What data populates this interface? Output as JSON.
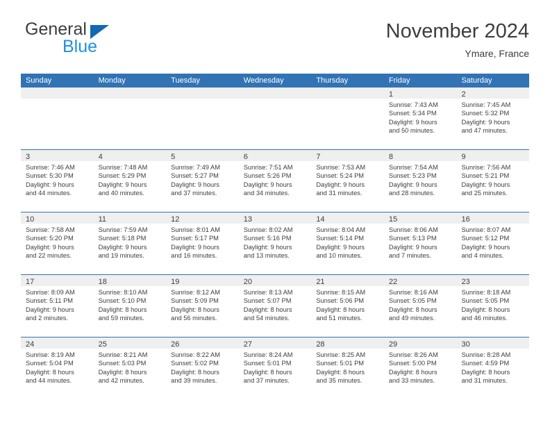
{
  "brand": {
    "name_primary": "General",
    "name_secondary": "Blue",
    "triangle_icon": "triangle-icon"
  },
  "header": {
    "title": "November 2024",
    "subtitle": "Ymare, France"
  },
  "colors": {
    "header_blue": "#3173b4",
    "brand_blue": "#1f8fe0",
    "brand_triangle_blue": "#1268b3",
    "day_band_gray": "#efefef",
    "text": "#3d3d3d"
  },
  "weekday_headers": [
    "Sunday",
    "Monday",
    "Tuesday",
    "Wednesday",
    "Thursday",
    "Friday",
    "Saturday"
  ],
  "weeks": [
    [
      {
        "day": "",
        "sunrise": "",
        "sunset": "",
        "daylight_line1": "",
        "daylight_line2": "",
        "empty": true
      },
      {
        "day": "",
        "sunrise": "",
        "sunset": "",
        "daylight_line1": "",
        "daylight_line2": "",
        "empty": true
      },
      {
        "day": "",
        "sunrise": "",
        "sunset": "",
        "daylight_line1": "",
        "daylight_line2": "",
        "empty": true
      },
      {
        "day": "",
        "sunrise": "",
        "sunset": "",
        "daylight_line1": "",
        "daylight_line2": "",
        "empty": true
      },
      {
        "day": "",
        "sunrise": "",
        "sunset": "",
        "daylight_line1": "",
        "daylight_line2": "",
        "empty": true
      },
      {
        "day": "1",
        "sunrise": "Sunrise: 7:43 AM",
        "sunset": "Sunset: 5:34 PM",
        "daylight_line1": "Daylight: 9 hours",
        "daylight_line2": "and 50 minutes.",
        "empty": false
      },
      {
        "day": "2",
        "sunrise": "Sunrise: 7:45 AM",
        "sunset": "Sunset: 5:32 PM",
        "daylight_line1": "Daylight: 9 hours",
        "daylight_line2": "and 47 minutes.",
        "empty": false
      }
    ],
    [
      {
        "day": "3",
        "sunrise": "Sunrise: 7:46 AM",
        "sunset": "Sunset: 5:30 PM",
        "daylight_line1": "Daylight: 9 hours",
        "daylight_line2": "and 44 minutes.",
        "empty": false
      },
      {
        "day": "4",
        "sunrise": "Sunrise: 7:48 AM",
        "sunset": "Sunset: 5:29 PM",
        "daylight_line1": "Daylight: 9 hours",
        "daylight_line2": "and 40 minutes.",
        "empty": false
      },
      {
        "day": "5",
        "sunrise": "Sunrise: 7:49 AM",
        "sunset": "Sunset: 5:27 PM",
        "daylight_line1": "Daylight: 9 hours",
        "daylight_line2": "and 37 minutes.",
        "empty": false
      },
      {
        "day": "6",
        "sunrise": "Sunrise: 7:51 AM",
        "sunset": "Sunset: 5:26 PM",
        "daylight_line1": "Daylight: 9 hours",
        "daylight_line2": "and 34 minutes.",
        "empty": false
      },
      {
        "day": "7",
        "sunrise": "Sunrise: 7:53 AM",
        "sunset": "Sunset: 5:24 PM",
        "daylight_line1": "Daylight: 9 hours",
        "daylight_line2": "and 31 minutes.",
        "empty": false
      },
      {
        "day": "8",
        "sunrise": "Sunrise: 7:54 AM",
        "sunset": "Sunset: 5:23 PM",
        "daylight_line1": "Daylight: 9 hours",
        "daylight_line2": "and 28 minutes.",
        "empty": false
      },
      {
        "day": "9",
        "sunrise": "Sunrise: 7:56 AM",
        "sunset": "Sunset: 5:21 PM",
        "daylight_line1": "Daylight: 9 hours",
        "daylight_line2": "and 25 minutes.",
        "empty": false
      }
    ],
    [
      {
        "day": "10",
        "sunrise": "Sunrise: 7:58 AM",
        "sunset": "Sunset: 5:20 PM",
        "daylight_line1": "Daylight: 9 hours",
        "daylight_line2": "and 22 minutes.",
        "empty": false
      },
      {
        "day": "11",
        "sunrise": "Sunrise: 7:59 AM",
        "sunset": "Sunset: 5:18 PM",
        "daylight_line1": "Daylight: 9 hours",
        "daylight_line2": "and 19 minutes.",
        "empty": false
      },
      {
        "day": "12",
        "sunrise": "Sunrise: 8:01 AM",
        "sunset": "Sunset: 5:17 PM",
        "daylight_line1": "Daylight: 9 hours",
        "daylight_line2": "and 16 minutes.",
        "empty": false
      },
      {
        "day": "13",
        "sunrise": "Sunrise: 8:02 AM",
        "sunset": "Sunset: 5:16 PM",
        "daylight_line1": "Daylight: 9 hours",
        "daylight_line2": "and 13 minutes.",
        "empty": false
      },
      {
        "day": "14",
        "sunrise": "Sunrise: 8:04 AM",
        "sunset": "Sunset: 5:14 PM",
        "daylight_line1": "Daylight: 9 hours",
        "daylight_line2": "and 10 minutes.",
        "empty": false
      },
      {
        "day": "15",
        "sunrise": "Sunrise: 8:06 AM",
        "sunset": "Sunset: 5:13 PM",
        "daylight_line1": "Daylight: 9 hours",
        "daylight_line2": "and 7 minutes.",
        "empty": false
      },
      {
        "day": "16",
        "sunrise": "Sunrise: 8:07 AM",
        "sunset": "Sunset: 5:12 PM",
        "daylight_line1": "Daylight: 9 hours",
        "daylight_line2": "and 4 minutes.",
        "empty": false
      }
    ],
    [
      {
        "day": "17",
        "sunrise": "Sunrise: 8:09 AM",
        "sunset": "Sunset: 5:11 PM",
        "daylight_line1": "Daylight: 9 hours",
        "daylight_line2": "and 2 minutes.",
        "empty": false
      },
      {
        "day": "18",
        "sunrise": "Sunrise: 8:10 AM",
        "sunset": "Sunset: 5:10 PM",
        "daylight_line1": "Daylight: 8 hours",
        "daylight_line2": "and 59 minutes.",
        "empty": false
      },
      {
        "day": "19",
        "sunrise": "Sunrise: 8:12 AM",
        "sunset": "Sunset: 5:09 PM",
        "daylight_line1": "Daylight: 8 hours",
        "daylight_line2": "and 56 minutes.",
        "empty": false
      },
      {
        "day": "20",
        "sunrise": "Sunrise: 8:13 AM",
        "sunset": "Sunset: 5:07 PM",
        "daylight_line1": "Daylight: 8 hours",
        "daylight_line2": "and 54 minutes.",
        "empty": false
      },
      {
        "day": "21",
        "sunrise": "Sunrise: 8:15 AM",
        "sunset": "Sunset: 5:06 PM",
        "daylight_line1": "Daylight: 8 hours",
        "daylight_line2": "and 51 minutes.",
        "empty": false
      },
      {
        "day": "22",
        "sunrise": "Sunrise: 8:16 AM",
        "sunset": "Sunset: 5:05 PM",
        "daylight_line1": "Daylight: 8 hours",
        "daylight_line2": "and 49 minutes.",
        "empty": false
      },
      {
        "day": "23",
        "sunrise": "Sunrise: 8:18 AM",
        "sunset": "Sunset: 5:05 PM",
        "daylight_line1": "Daylight: 8 hours",
        "daylight_line2": "and 46 minutes.",
        "empty": false
      }
    ],
    [
      {
        "day": "24",
        "sunrise": "Sunrise: 8:19 AM",
        "sunset": "Sunset: 5:04 PM",
        "daylight_line1": "Daylight: 8 hours",
        "daylight_line2": "and 44 minutes.",
        "empty": false
      },
      {
        "day": "25",
        "sunrise": "Sunrise: 8:21 AM",
        "sunset": "Sunset: 5:03 PM",
        "daylight_line1": "Daylight: 8 hours",
        "daylight_line2": "and 42 minutes.",
        "empty": false
      },
      {
        "day": "26",
        "sunrise": "Sunrise: 8:22 AM",
        "sunset": "Sunset: 5:02 PM",
        "daylight_line1": "Daylight: 8 hours",
        "daylight_line2": "and 39 minutes.",
        "empty": false
      },
      {
        "day": "27",
        "sunrise": "Sunrise: 8:24 AM",
        "sunset": "Sunset: 5:01 PM",
        "daylight_line1": "Daylight: 8 hours",
        "daylight_line2": "and 37 minutes.",
        "empty": false
      },
      {
        "day": "28",
        "sunrise": "Sunrise: 8:25 AM",
        "sunset": "Sunset: 5:01 PM",
        "daylight_line1": "Daylight: 8 hours",
        "daylight_line2": "and 35 minutes.",
        "empty": false
      },
      {
        "day": "29",
        "sunrise": "Sunrise: 8:26 AM",
        "sunset": "Sunset: 5:00 PM",
        "daylight_line1": "Daylight: 8 hours",
        "daylight_line2": "and 33 minutes.",
        "empty": false
      },
      {
        "day": "30",
        "sunrise": "Sunrise: 8:28 AM",
        "sunset": "Sunset: 4:59 PM",
        "daylight_line1": "Daylight: 8 hours",
        "daylight_line2": "and 31 minutes.",
        "empty": false
      }
    ]
  ]
}
